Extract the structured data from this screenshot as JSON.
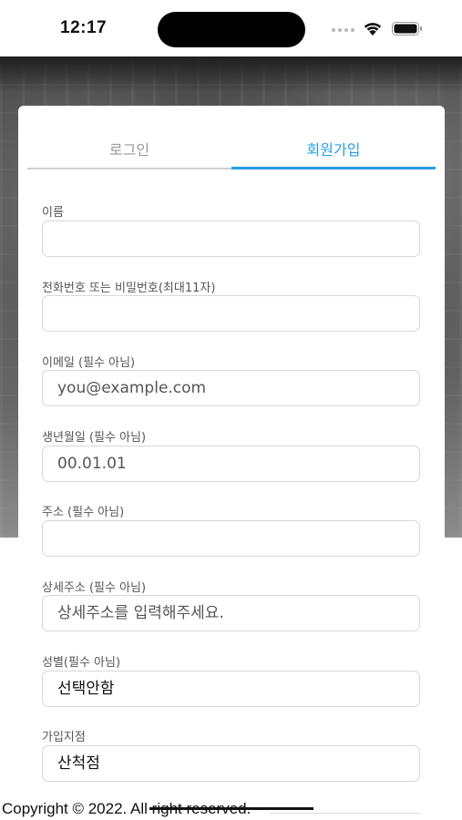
{
  "status_bar": {
    "time": "12:17"
  },
  "tabs": [
    {
      "label": "로그인",
      "active": false
    },
    {
      "label": "회원가입",
      "active": true
    }
  ],
  "accent_color": "#2a9fe0",
  "form": {
    "fields": [
      {
        "label": "이름",
        "value": "",
        "placeholder": ""
      },
      {
        "label": "전화번호 또는 비밀번호(최대11자)",
        "value": "",
        "placeholder": ""
      },
      {
        "label": "이메일 (필수 아님)",
        "value": "",
        "placeholder": "you@example.com"
      },
      {
        "label": "생년월일 (필수 아님)",
        "value": "",
        "placeholder": "00.01.01"
      },
      {
        "label": "주소 (필수 아님)",
        "value": "",
        "placeholder": ""
      },
      {
        "label": "상세주소 (필수 아님)",
        "value": "",
        "placeholder": "상세주소를 입력해주세요."
      },
      {
        "label": "성별(필수 아님)",
        "selected": "선택안함"
      },
      {
        "label": "가입지점",
        "selected": "산척점"
      }
    ]
  },
  "footer": {
    "copyright": "Copyright © 2022. All right reserved."
  }
}
